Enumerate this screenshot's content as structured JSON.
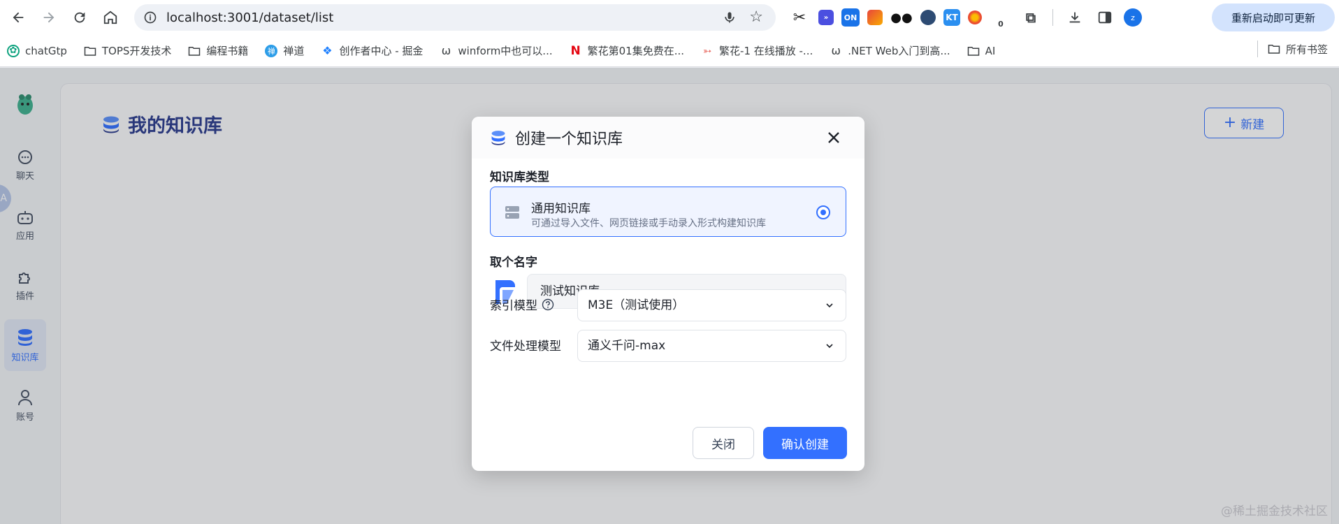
{
  "browser": {
    "url": "localhost:3001/dataset/list",
    "restart_label": "重新启动即可更新",
    "profile_initial": "z",
    "extensions": [
      {
        "name": "scissors-icon",
        "label": "",
        "color": "#ffffff"
      },
      {
        "name": "chat-extension-icon",
        "label": "",
        "color": "#4b4fe0"
      },
      {
        "name": "on-extension-icon",
        "label": "ON",
        "color": "#1a73e8"
      },
      {
        "name": "screenshot-extension-icon",
        "label": "",
        "color": "#e8453c"
      },
      {
        "name": "glasses-extension-icon",
        "label": "",
        "color": "#111111"
      },
      {
        "name": "globe-extension-icon",
        "label": "",
        "color": "#2d4b73"
      },
      {
        "name": "kt-extension-icon",
        "label": "KT",
        "color": "#2b8ff0"
      },
      {
        "name": "color-extension-icon",
        "label": "",
        "color": "#f28c28"
      },
      {
        "name": "sync-extension-icon",
        "label": "0",
        "color": "#ffffff"
      }
    ]
  },
  "bookmarks": {
    "items": [
      {
        "label": "chatGtp",
        "icon": "openai-icon"
      },
      {
        "label": "TOPS开发技术",
        "icon": "folder-icon"
      },
      {
        "label": "编程书籍",
        "icon": "folder-icon"
      },
      {
        "label": "禅道",
        "icon": "zentao-icon"
      },
      {
        "label": "创作者中心 - 掘金",
        "icon": "juejin-icon"
      },
      {
        "label": "winform中也可以...",
        "icon": "omega-icon"
      },
      {
        "label": "繁花第01集免费在...",
        "icon": "netflix-icon"
      },
      {
        "label": "繁花-1 在线播放 -...",
        "icon": "fish-icon"
      },
      {
        "label": ".NET Web入门到高...",
        "icon": "omega-icon"
      },
      {
        "label": "AI",
        "icon": "folder-icon"
      }
    ],
    "all_bookmarks": "所有书签"
  },
  "nav": {
    "items": [
      {
        "label": "聊天",
        "icon": "chat-icon"
      },
      {
        "label": "应用",
        "icon": "robot-icon"
      },
      {
        "label": "插件",
        "icon": "puzzle-icon"
      },
      {
        "label": "知识库",
        "icon": "database-icon"
      },
      {
        "label": "账号",
        "icon": "user-icon"
      }
    ],
    "active": "知识库",
    "fab_label": "A"
  },
  "page": {
    "title": "我的知识库",
    "new_button": "新建"
  },
  "modal": {
    "title": "创建一个知识库",
    "type_section": "知识库类型",
    "type_name": "通用知识库",
    "type_desc": "可通过导入文件、网页链接或手动录入形式构建知识库",
    "name_section": "取个名字",
    "name_value": "测试知识库",
    "index_model_label": "索引模型",
    "index_model_value": "M3E（测试使用）",
    "file_model_label": "文件处理模型",
    "file_model_value": "通义千问-max",
    "close_button": "关闭",
    "confirm_button": "确认创建"
  },
  "watermark": "@稀土掘金技术社区",
  "colors": {
    "accent": "#3370ff",
    "title": "#2a3a8c"
  }
}
